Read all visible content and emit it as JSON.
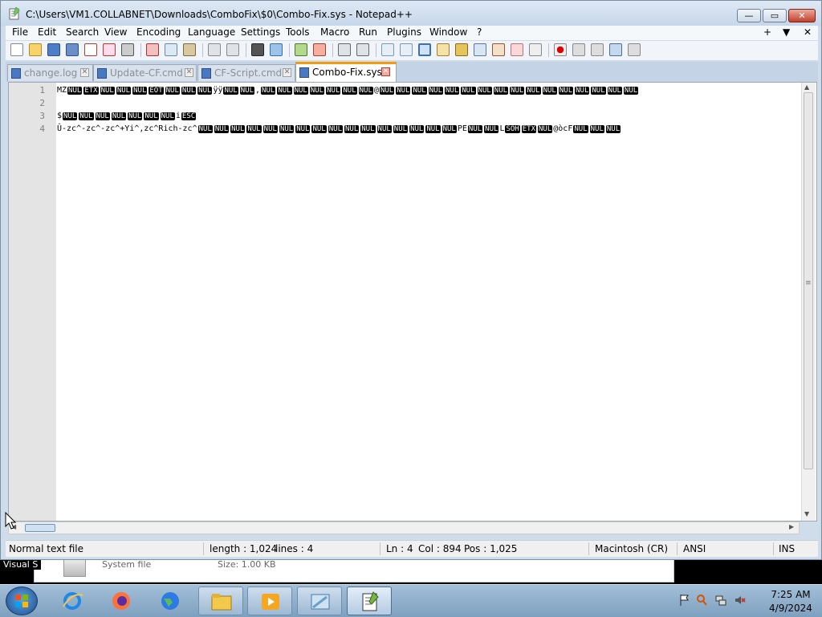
{
  "window": {
    "title": "C:\\Users\\VM1.COLLABNET\\Downloads\\ComboFix\\$0\\Combo-Fix.sys - Notepad++",
    "controls": {
      "minimize": "—",
      "maximize": "▭",
      "close": "✕"
    }
  },
  "menu": {
    "items": [
      "File",
      "Edit",
      "Search",
      "View",
      "Encoding",
      "Language",
      "Settings",
      "Tools",
      "Macro",
      "Run",
      "Plugins",
      "Window",
      "?"
    ],
    "right_controls": [
      "+",
      "▼",
      "✕"
    ]
  },
  "toolbar": {
    "icons": [
      "new-file-icon",
      "open-file-icon",
      "save-icon",
      "save-all-icon",
      "close-icon",
      "close-all-icon",
      "print-icon",
      "cut-icon",
      "copy-icon",
      "paste-icon",
      "undo-icon",
      "redo-icon",
      "find-icon",
      "replace-icon",
      "zoom-in-icon",
      "zoom-out-icon",
      "sync-vertical-icon",
      "sync-horizontal-icon",
      "word-wrap-icon",
      "show-all-chars-icon",
      "indent-guide-icon",
      "udl-icon",
      "doc-map-icon",
      "function-list-icon",
      "folder-workspace-icon",
      "monitor-icon",
      "record-macro-icon",
      "stop-macro-icon",
      "play-macro-icon",
      "run-macro-multiple-icon",
      "save-macro-icon"
    ]
  },
  "tabs": [
    {
      "label": "change.log",
      "active": false
    },
    {
      "label": "Update-CF.cmd",
      "active": false
    },
    {
      "label": "CF-Script.cmd",
      "active": false
    },
    {
      "label": "Combo-Fix.sys",
      "active": true
    }
  ],
  "editor": {
    "line_numbers": [
      "1",
      "2",
      "3",
      "4"
    ],
    "lines": [
      [
        {
          "t": "MZ"
        },
        {
          "c": "NUL"
        },
        {
          "c": "ETX"
        },
        {
          "c": "NUL"
        },
        {
          "c": "NUL"
        },
        {
          "c": "NUL"
        },
        {
          "c": "EOT"
        },
        {
          "c": "NUL"
        },
        {
          "c": "NUL"
        },
        {
          "c": "NUL"
        },
        {
          "t": "ÿÿ"
        },
        {
          "c": "NUL"
        },
        {
          "c": "NUL"
        },
        {
          "t": ","
        },
        {
          "c": "NUL"
        },
        {
          "c": "NUL"
        },
        {
          "c": "NUL"
        },
        {
          "c": "NUL"
        },
        {
          "c": "NUL"
        },
        {
          "c": "NUL"
        },
        {
          "c": "NUL"
        },
        {
          "t": "@"
        },
        {
          "c": "NUL"
        },
        {
          "c": "NUL"
        },
        {
          "c": "NUL"
        },
        {
          "c": "NUL"
        },
        {
          "c": "NUL"
        },
        {
          "c": "NUL"
        },
        {
          "c": "NUL"
        },
        {
          "c": "NUL"
        },
        {
          "c": "NUL"
        },
        {
          "c": "NUL"
        },
        {
          "c": "NUL"
        },
        {
          "c": "NUL"
        },
        {
          "c": "NUL"
        },
        {
          "c": "NUL"
        },
        {
          "c": "NUL"
        },
        {
          "c": "NUL"
        }
      ],
      [],
      [
        {
          "t": "$"
        },
        {
          "c": "NUL"
        },
        {
          "c": "NUL"
        },
        {
          "c": "NUL"
        },
        {
          "c": "NUL"
        },
        {
          "c": "NUL"
        },
        {
          "c": "NUL"
        },
        {
          "c": "NUL"
        },
        {
          "t": "i"
        },
        {
          "c": "ESC"
        }
      ],
      [
        {
          "t": "Û-zc^-zc^-zc^+Yi^,zc^Rich-zc^"
        },
        {
          "c": "NUL"
        },
        {
          "c": "NUL"
        },
        {
          "c": "NUL"
        },
        {
          "c": "NUL"
        },
        {
          "c": "NUL"
        },
        {
          "c": "NUL"
        },
        {
          "c": "NUL"
        },
        {
          "c": "NUL"
        },
        {
          "c": "NUL"
        },
        {
          "c": "NUL"
        },
        {
          "c": "NUL"
        },
        {
          "c": "NUL"
        },
        {
          "c": "NUL"
        },
        {
          "c": "NUL"
        },
        {
          "c": "NUL"
        },
        {
          "c": "NUL"
        },
        {
          "t": "PE"
        },
        {
          "c": "NUL"
        },
        {
          "c": "NUL"
        },
        {
          "t": "L"
        },
        {
          "c": "SOH"
        },
        {
          "c": "ETX"
        },
        {
          "c": "NUL"
        },
        {
          "t": "@òcF"
        },
        {
          "c": "NUL"
        },
        {
          "c": "NUL"
        },
        {
          "c": "NUL"
        }
      ]
    ]
  },
  "statusbar": {
    "file_type": "Normal text file",
    "length": "length : 1,024",
    "lines": "lines : 4",
    "ln": "Ln : 4",
    "col": "Col : 894",
    "pos": "Pos : 1,025",
    "eol": "Macintosh (CR)",
    "encoding": "ANSI",
    "mode": "INS"
  },
  "background_window": {
    "visual_label": "Visual S",
    "item_name": "System file",
    "item_size": "Size: 1.00 KB"
  },
  "taskbar": {
    "apps": [
      "internet-explorer-icon",
      "firefox-icon",
      "globe-icon",
      "file-explorer-icon",
      "media-player-icon",
      "window-icon",
      "notepadplusplus-icon"
    ],
    "time": "7:25 AM",
    "date": "4/9/2024"
  },
  "colors": {
    "accent_tab": "#f39c11",
    "control_char_bg": "#000000",
    "gutter": "#e4e4e4"
  }
}
